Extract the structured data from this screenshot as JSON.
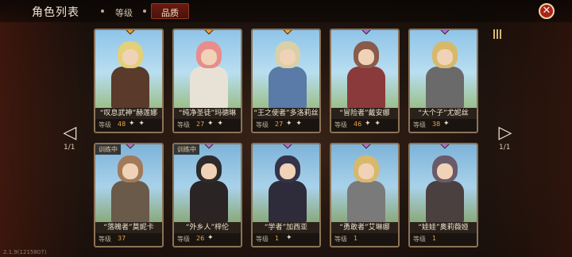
{
  "header": {
    "title": "角色列表",
    "tabs": [
      {
        "label": "等级",
        "active": false
      },
      {
        "label": "品质",
        "active": true
      }
    ],
    "close_icon": "close-icon"
  },
  "pagination": {
    "left_page": "1/1",
    "right_page": "1/1",
    "left_icon": "arrow-left-icon",
    "right_icon": "arrow-right-icon"
  },
  "filter_icon": "sort-filter-icon",
  "level_label": "等级",
  "training_label": "训练中",
  "version": "2.1.9(1215807)",
  "colors": {
    "gem_orange": "#f0a23c",
    "gem_purple": "#a873e0",
    "level_value": "#f0a23c",
    "close_red": "#a8231a"
  },
  "cards": [
    {
      "name": "“叹息武神”赫莲娜",
      "level": "48",
      "stars": "✦ ✦",
      "gem": "orange",
      "training": false
    },
    {
      "name": "“纯净圣徒”玛德琳",
      "level": "27",
      "stars": "✦ ✦",
      "gem": "orange",
      "training": false
    },
    {
      "name": "“王之使者”多洛莉丝",
      "level": "27",
      "stars": "✦ ✦",
      "gem": "orange",
      "training": false
    },
    {
      "name": "“冒险者”戴安娜",
      "level": "46",
      "stars": "✦ ✦",
      "gem": "purple",
      "training": false
    },
    {
      "name": "“大个子”尤妮丝",
      "level": "38",
      "stars": "✦",
      "gem": "purple",
      "training": false
    },
    {
      "name": "“落魄者”莫妮卡",
      "level": "37",
      "stars": "",
      "gem": "purple",
      "training": true
    },
    {
      "name": "“外乡人”梓伦",
      "level": "26",
      "stars": "✦",
      "gem": "purple",
      "training": true
    },
    {
      "name": "“学者”加西亚",
      "level": "1",
      "stars": "✦",
      "gem": "purple",
      "training": false
    },
    {
      "name": "“勇敢者”艾琳娜",
      "level": "1",
      "stars": "",
      "gem": "purple",
      "training": false
    },
    {
      "name": "“娃娃”奥莉薇娅",
      "level": "1",
      "stars": "",
      "gem": "purple",
      "training": false
    }
  ]
}
